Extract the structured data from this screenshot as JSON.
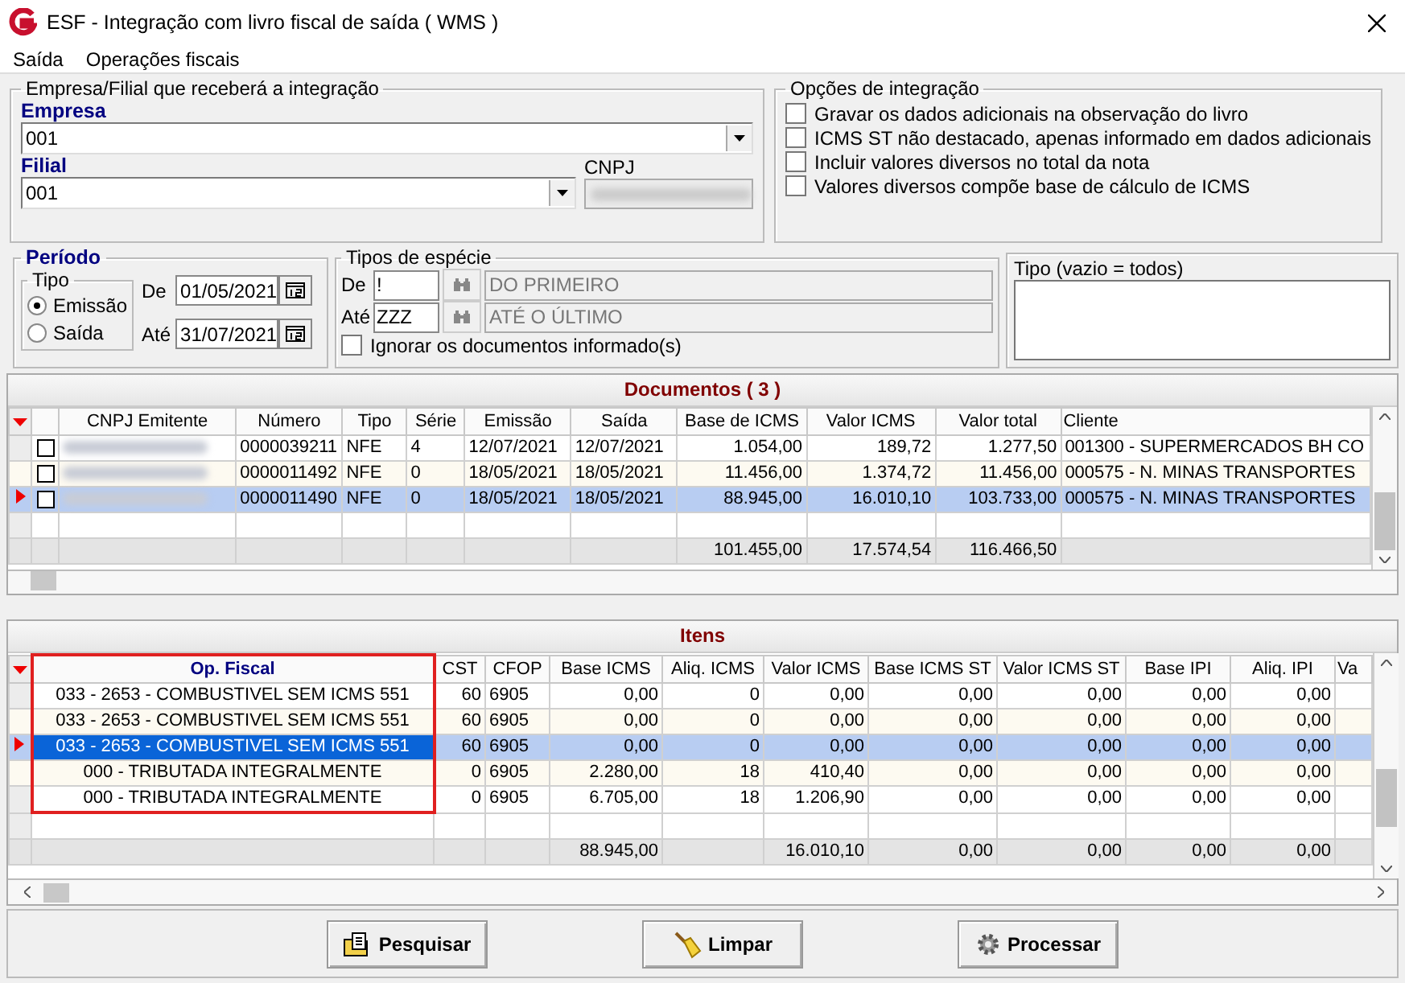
{
  "window": {
    "title": "ESF - Integração com livro fiscal de saída ( WMS )"
  },
  "menu": [
    {
      "label": "Saída"
    },
    {
      "label": "Operações fiscais"
    }
  ],
  "empresa_group": {
    "legend": "Empresa/Filial que receberá a integração",
    "empresa_label": "Empresa",
    "empresa_value": "001",
    "filial_label": "Filial",
    "filial_value": "001",
    "cnpj_label": "CNPJ"
  },
  "options": {
    "legend": "Opções de integração",
    "items": [
      {
        "label": "Gravar os dados adicionais na observação do livro",
        "checked": false
      },
      {
        "label": "ICMS ST  não destacado, apenas informado em dados adicionais",
        "checked": false
      },
      {
        "label": "Incluir valores diversos no total da nota",
        "checked": false
      },
      {
        "label": "Valores diversos compõe base de cálculo de ICMS",
        "checked": false
      }
    ]
  },
  "periodo": {
    "legend": "Período",
    "tipo_legend": "Tipo",
    "radios": [
      {
        "label": "Emissão",
        "selected": true
      },
      {
        "label": "Saída",
        "selected": false
      }
    ],
    "de_label": "De",
    "de_value": "01/05/2021",
    "ate_label": "Até",
    "ate_value": "31/07/2021"
  },
  "especie": {
    "legend": "Tipos de espécie",
    "de_label": "De",
    "de_value": "!",
    "de_desc": "DO PRIMEIRO",
    "ate_label": "Até",
    "ate_value": "ZZZ",
    "ate_desc": "ATÉ O ÚLTIMO",
    "ignore": {
      "label": "Ignorar os documentos informado(s)",
      "checked": false
    }
  },
  "tipo": {
    "label": "Tipo (vazio = todos)"
  },
  "documents": {
    "title": "Documentos ( 3 )",
    "cnpj_column": "CNPJ Emitente",
    "columns": [
      "Número",
      "Tipo",
      "Série",
      "Emissão",
      "Saída",
      "Base de ICMS",
      "Valor ICMS",
      "Valor total",
      "Cliente"
    ],
    "rows": [
      {
        "checked": false,
        "selected": false,
        "cells": [
          "0000039211",
          "NFE",
          "4",
          "12/07/2021",
          "12/07/2021",
          "1.054,00",
          "189,72",
          "1.277,50",
          "001300 - SUPERMERCADOS BH CO"
        ]
      },
      {
        "checked": false,
        "selected": false,
        "cells": [
          "0000011492",
          "NFE",
          "0",
          "18/05/2021",
          "18/05/2021",
          "11.456,00",
          "1.374,72",
          "11.456,00",
          "000575 - N. MINAS TRANSPORTES"
        ]
      },
      {
        "checked": false,
        "selected": true,
        "cells": [
          "0000011490",
          "NFE",
          "0",
          "18/05/2021",
          "18/05/2021",
          "88.945,00",
          "16.010,10",
          "103.733,00",
          "000575 - N. MINAS TRANSPORTES"
        ]
      }
    ],
    "totals": [
      "101.455,00",
      "17.574,54",
      "116.466,50"
    ]
  },
  "items": {
    "title": "Itens",
    "columns": [
      {
        "label": "Op. Fiscal",
        "highlighted": true
      },
      {
        "label": "CST",
        "highlighted": false
      },
      {
        "label": "CFOP",
        "highlighted": false
      },
      {
        "label": "Base ICMS",
        "highlighted": false
      },
      {
        "label": "Aliq. ICMS",
        "highlighted": false
      },
      {
        "label": "Valor ICMS",
        "highlighted": false
      },
      {
        "label": "Base ICMS ST",
        "highlighted": false
      },
      {
        "label": "Valor ICMS ST",
        "highlighted": false
      },
      {
        "label": "Base IPI",
        "highlighted": false
      },
      {
        "label": "Aliq. IPI",
        "highlighted": false
      },
      {
        "label": "Va",
        "highlighted": false
      }
    ],
    "rows": [
      {
        "selected": false,
        "cells": [
          "033 - 2653 - COMBUSTIVEL SEM ICMS 551",
          "60",
          "6905",
          "0,00",
          "0",
          "0,00",
          "0,00",
          "0,00",
          "0,00",
          "0,00"
        ]
      },
      {
        "selected": false,
        "cells": [
          "033 - 2653 - COMBUSTIVEL SEM ICMS 551",
          "60",
          "6905",
          "0,00",
          "0",
          "0,00",
          "0,00",
          "0,00",
          "0,00",
          "0,00"
        ]
      },
      {
        "selected": true,
        "cells": [
          "033 - 2653 - COMBUSTIVEL SEM ICMS 551",
          "60",
          "6905",
          "0,00",
          "0",
          "0,00",
          "0,00",
          "0,00",
          "0,00",
          "0,00"
        ]
      },
      {
        "selected": false,
        "cells": [
          "000 - TRIBUTADA INTEGRALMENTE",
          "0",
          "6905",
          "2.280,00",
          "18",
          "410,40",
          "0,00",
          "0,00",
          "0,00",
          "0,00"
        ]
      },
      {
        "selected": false,
        "cells": [
          "000 - TRIBUTADA INTEGRALMENTE",
          "0",
          "6905",
          "6.705,00",
          "18",
          "1.206,90",
          "0,00",
          "0,00",
          "0,00",
          "0,00"
        ]
      }
    ],
    "totals": [
      "88.945,00",
      "16.010,10",
      "0,00",
      "0,00",
      "0,00",
      "0,00"
    ]
  },
  "buttons": [
    {
      "label": "Pesquisar",
      "kind": "search"
    },
    {
      "label": "Limpar",
      "kind": "clear"
    },
    {
      "label": "Processar",
      "kind": "process"
    }
  ]
}
